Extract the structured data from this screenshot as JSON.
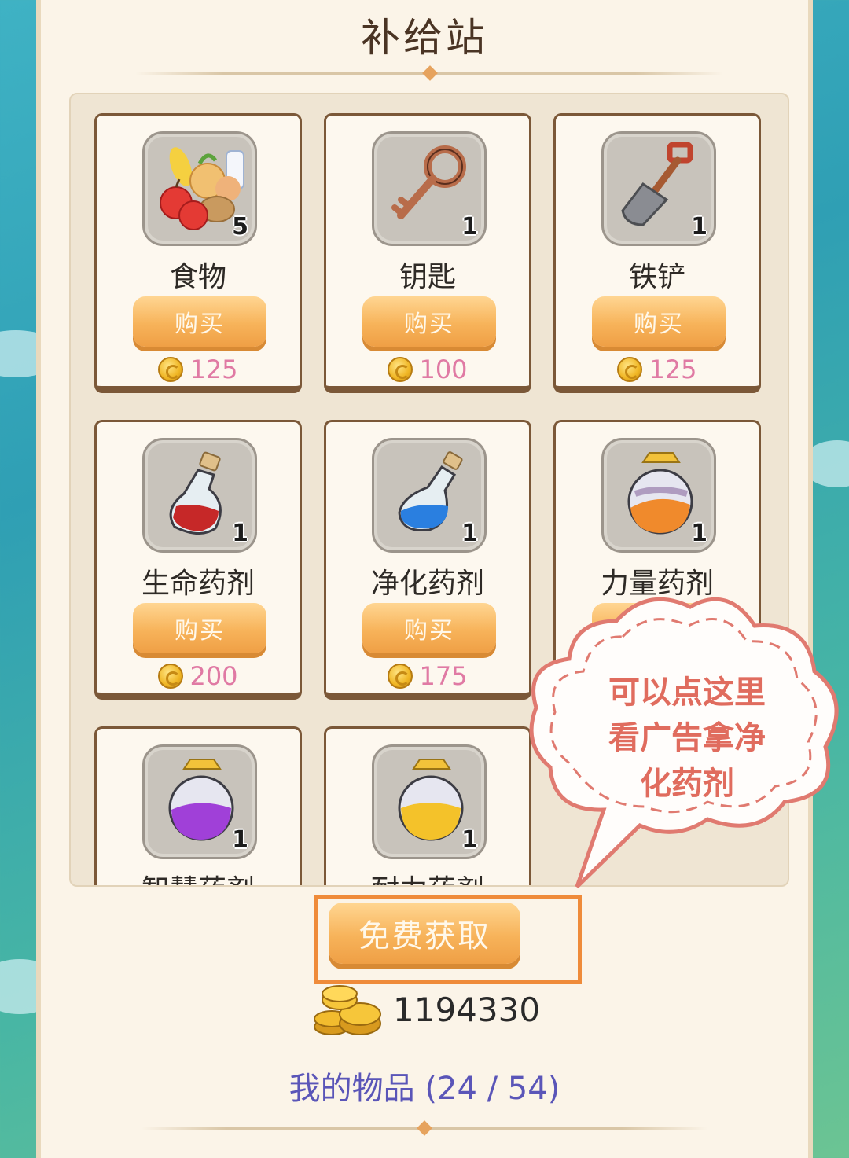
{
  "header": {
    "title": "补给站"
  },
  "items": [
    {
      "name": "食物",
      "qty": "5",
      "icon": "food-icon",
      "buy_label": "购买",
      "price": "125"
    },
    {
      "name": "钥匙",
      "qty": "1",
      "icon": "key-icon",
      "buy_label": "购买",
      "price": "100"
    },
    {
      "name": "铁铲",
      "qty": "1",
      "icon": "shovel-icon",
      "buy_label": "购买",
      "price": "125"
    },
    {
      "name": "生命药剂",
      "qty": "1",
      "icon": "red-potion-icon",
      "buy_label": "购买",
      "price": "200"
    },
    {
      "name": "净化药剂",
      "qty": "1",
      "icon": "blue-potion-icon",
      "buy_label": "购买",
      "price": "175"
    },
    {
      "name": "力量药剂",
      "qty": "1",
      "icon": "orange-potion-icon"
    },
    {
      "name": "智慧药剂",
      "qty": "1",
      "icon": "purple-potion-icon"
    },
    {
      "name": "耐力药剂",
      "qty": "1",
      "icon": "yellow-potion-icon"
    }
  ],
  "annotation": {
    "line1": "可以点这里",
    "line2": "看广告拿净",
    "line3": "化药剂"
  },
  "free_button": {
    "label": "免费获取"
  },
  "balance": {
    "value": "1194330"
  },
  "inventory": {
    "label": "我的物品 (24 / 54)"
  },
  "colors": {
    "accent": "#f7b35a",
    "card_border": "#7b5838",
    "price": "#e07aa4",
    "highlight": "#ef8b3a",
    "annotation": "#e06c5e"
  }
}
